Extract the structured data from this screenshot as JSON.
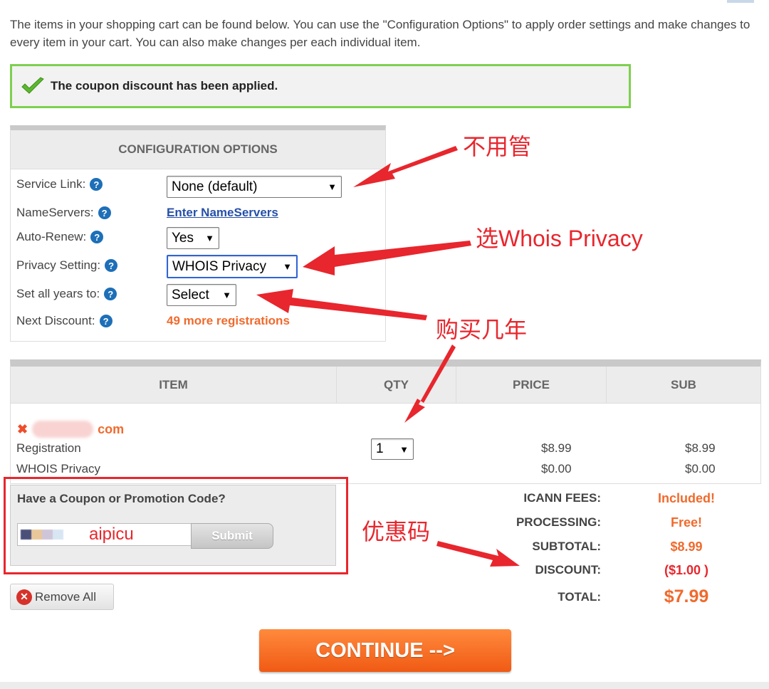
{
  "intro_text": "The items in your shopping cart can be found below. You can use the \"Configuration Options\" to apply order settings and make changes to every item in your cart. You can also make changes per each individual item.",
  "alert": {
    "text": "The coupon discount has been applied."
  },
  "config": {
    "title": "CONFIGURATION OPTIONS",
    "rows": [
      {
        "label": "Service Link:",
        "value": "None (default)"
      },
      {
        "label": "NameServers:",
        "value": "Enter NameServers"
      },
      {
        "label": "Auto-Renew:",
        "value": "Yes"
      },
      {
        "label": "Privacy Setting:",
        "value": "WHOIS Privacy"
      },
      {
        "label": "Set all years to:",
        "value": "Select"
      },
      {
        "label": "Next Discount:",
        "value": "49 more registrations"
      }
    ]
  },
  "table": {
    "headers": [
      "ITEM",
      "QTY",
      "PRICE",
      "SUB"
    ],
    "domain_tld": "com",
    "rows": [
      {
        "item": "Registration",
        "qty": "1",
        "price": "$8.99",
        "sub": "$8.99"
      },
      {
        "item": "WHOIS Privacy",
        "price": "$0.00",
        "sub": "$0.00"
      }
    ]
  },
  "coupon": {
    "title": "Have a Coupon or Promotion Code?",
    "value": "aipicu",
    "submit_label": "Submit"
  },
  "remove_all_label": "Remove All",
  "totals": [
    {
      "label": "ICANN FEES:",
      "value": "Included!"
    },
    {
      "label": "PROCESSING:",
      "value": "Free!"
    },
    {
      "label": "SUBTOTAL:",
      "value": "$8.99"
    },
    {
      "label": "DISCOUNT:",
      "value": "($1.00 )"
    },
    {
      "label": "TOTAL:",
      "value": "$7.99"
    }
  ],
  "continue_label": "CONTINUE -->",
  "annotations": {
    "service_link_note": "不用管",
    "privacy_note": "选Whois Privacy",
    "years_note": "购买几年",
    "coupon_note": "优惠码"
  },
  "colors": {
    "accent_orange": "#f06a2d",
    "annotation_red": "#e8262d",
    "success_green": "#7ed04f",
    "link_blue": "#2650a8"
  }
}
